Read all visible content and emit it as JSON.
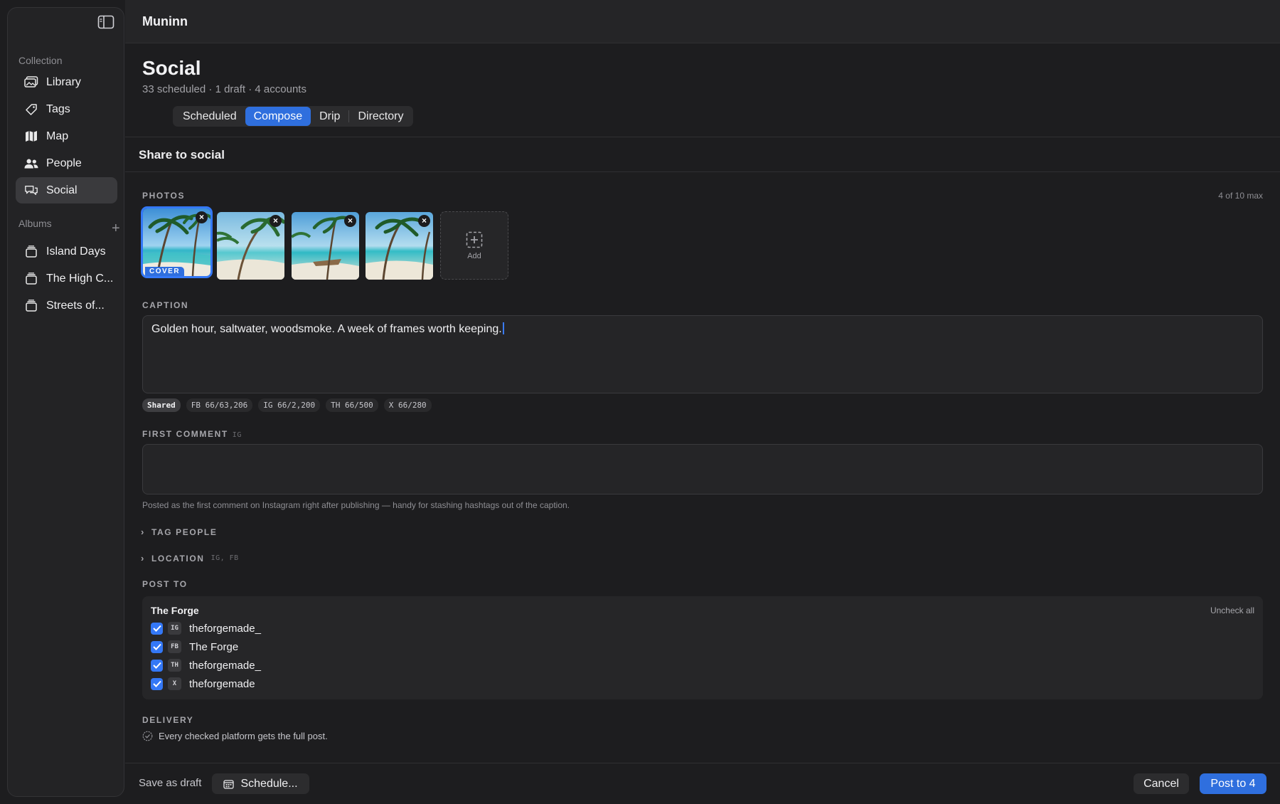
{
  "app": {
    "title": "Muninn"
  },
  "sidebar": {
    "collection_label": "Collection",
    "items": [
      {
        "label": "Library",
        "icon": "photo-library-icon"
      },
      {
        "label": "Tags",
        "icon": "tag-icon"
      },
      {
        "label": "Map",
        "icon": "map-icon"
      },
      {
        "label": "People",
        "icon": "people-icon"
      },
      {
        "label": "Social",
        "icon": "chat-bubbles-icon",
        "active": true
      }
    ],
    "albums_label": "Albums",
    "albums": [
      {
        "label": "Island Days"
      },
      {
        "label": "The High C..."
      },
      {
        "label": "Streets of..."
      }
    ]
  },
  "header": {
    "title": "Social",
    "subtitle": "33 scheduled · 1 draft · 4 accounts",
    "tabs": [
      {
        "label": "Scheduled"
      },
      {
        "label": "Compose",
        "active": true
      },
      {
        "label": "Drip"
      },
      {
        "label": "Directory"
      }
    ]
  },
  "compose": {
    "title": "Share to social",
    "photos": {
      "label": "PHOTOS",
      "count": "4 of 10 max",
      "cover_badge": "COVER",
      "add_label": "Add"
    },
    "caption": {
      "label": "CAPTION",
      "value": "Golden hour, saltwater, woodsmoke. A week of frames worth keeping."
    },
    "counters": [
      {
        "label": "Shared",
        "active": true
      },
      {
        "label": "FB 66/63,206"
      },
      {
        "label": "IG 66/2,200"
      },
      {
        "label": "TH 66/500"
      },
      {
        "label": "X 66/280"
      }
    ],
    "first_comment": {
      "label": "FIRST COMMENT",
      "tag": "IG",
      "value": "",
      "helper": "Posted as the first comment on Instagram right after publishing — handy for stashing hashtags out of the caption."
    },
    "tag_people": {
      "label": "TAG PEOPLE"
    },
    "location": {
      "label": "LOCATION",
      "tag": "IG, FB"
    },
    "post_to": {
      "label": "POST TO",
      "group": "The Forge",
      "uncheck_all": "Uncheck all",
      "accounts": [
        {
          "platform": "IG",
          "name": "theforgemade_",
          "checked": true
        },
        {
          "platform": "FB",
          "name": "The Forge",
          "checked": true
        },
        {
          "platform": "TH",
          "name": "theforgemade_",
          "checked": true
        },
        {
          "platform": "X",
          "name": "theforgemade",
          "checked": true
        }
      ]
    },
    "delivery": {
      "label": "DELIVERY",
      "text": "Every checked platform gets the full post."
    }
  },
  "footer": {
    "save_draft": "Save as draft",
    "schedule": "Schedule...",
    "cancel": "Cancel",
    "post": "Post to 4"
  },
  "colors": {
    "accent": "#2f6fde",
    "background": "#1d1d1f",
    "sidebar": "#232325"
  }
}
